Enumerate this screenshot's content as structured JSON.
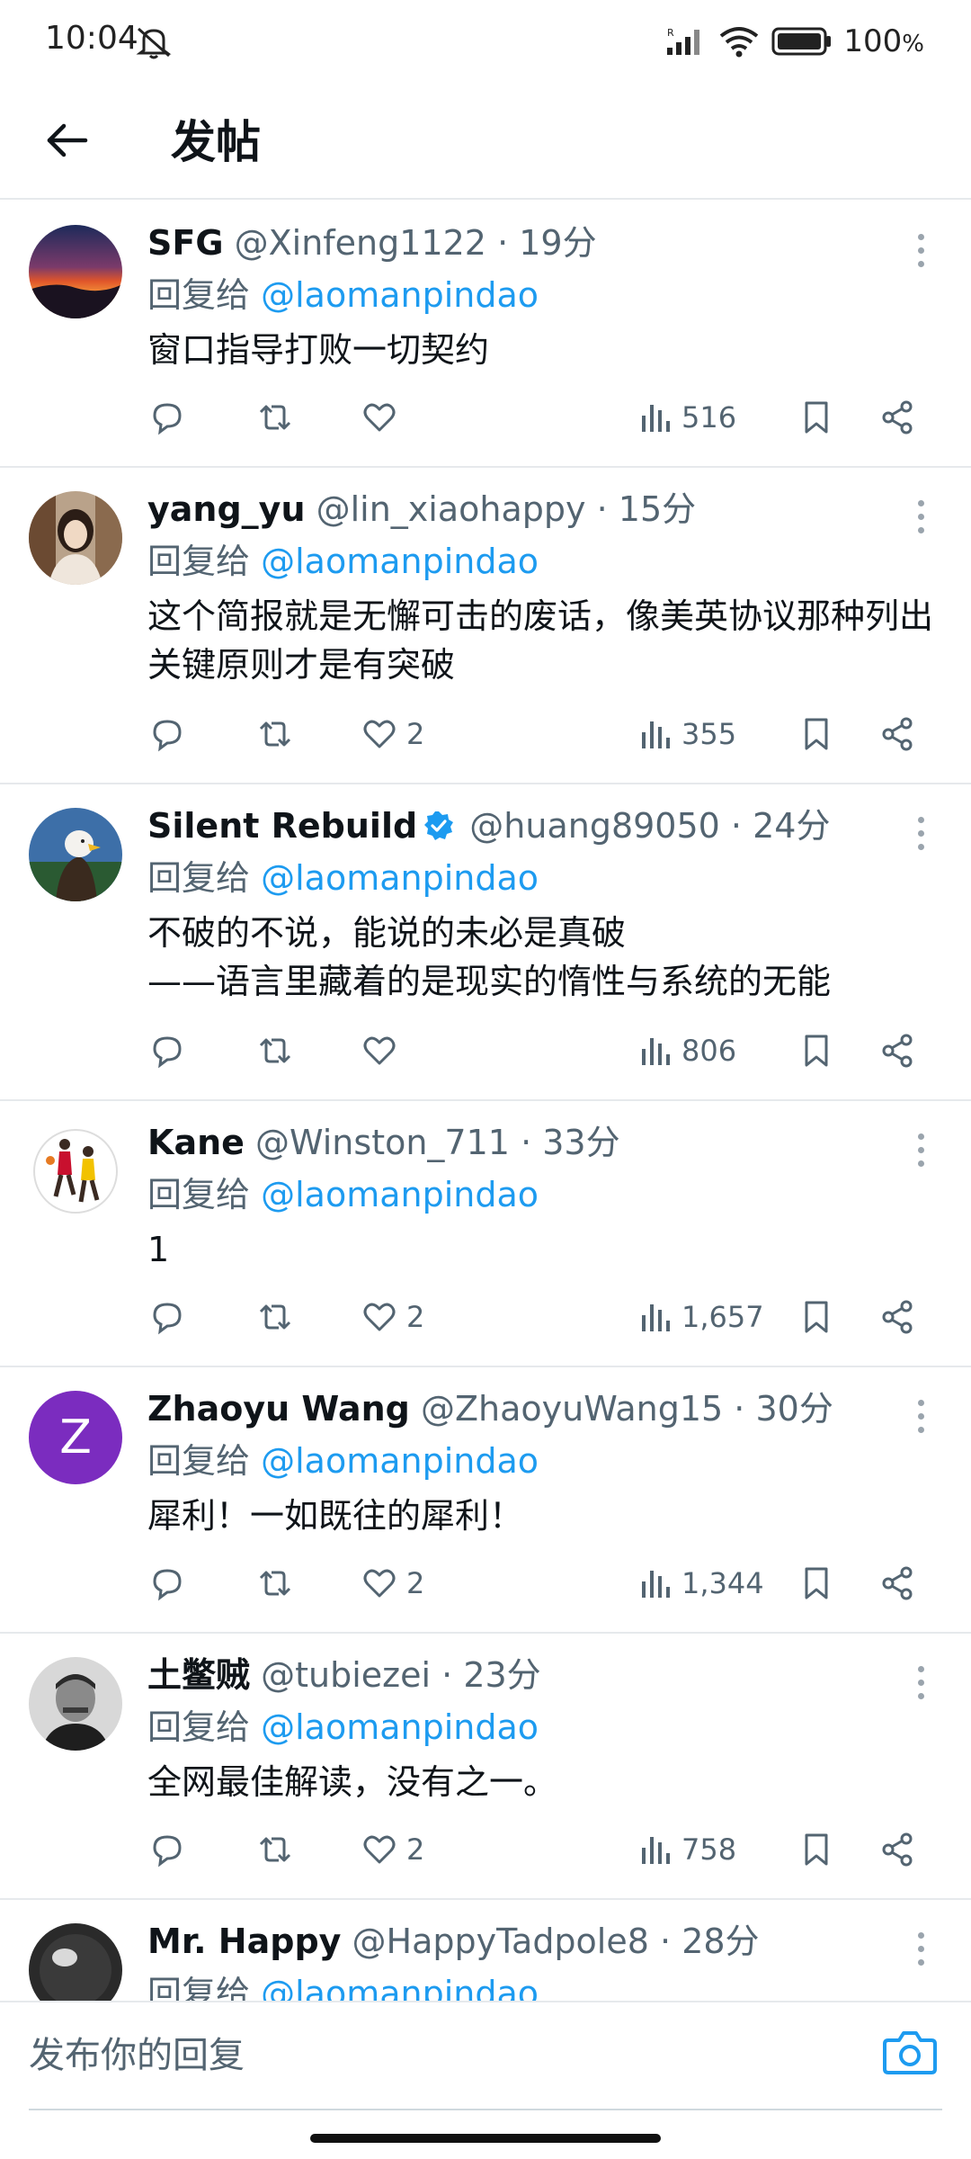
{
  "status_bar": {
    "time": "10:04",
    "battery_percent": "100",
    "battery_unit": "%"
  },
  "header": {
    "title": "发帖"
  },
  "replies": [
    {
      "name": "SFG",
      "handle": "@Xinfeng1122",
      "separator": "·",
      "time": "19分",
      "reply_prefix": "回复给",
      "reply_to": "@laomanpindao",
      "text": "窗口指导打败一切契约",
      "likes": "",
      "views": "516",
      "verified": false,
      "avatar": "sunset-avatar"
    },
    {
      "name": "yang_yu",
      "handle": "@lin_xiaohappy",
      "separator": "·",
      "time": "15分",
      "reply_prefix": "回复给",
      "reply_to": "@laomanpindao",
      "text": "这个简报就是无懈可击的废话，像美英协议那种列出关键原则才是有突破",
      "likes": "2",
      "views": "355",
      "verified": false,
      "avatar": "woman-photo-avatar"
    },
    {
      "name": "Silent Rebuild",
      "handle": "@huang89050",
      "separator": "·",
      "time": "24分",
      "reply_prefix": "回复给",
      "reply_to": "@laomanpindao",
      "text": "不破的不说，能说的未必是真破\n——语言里藏着的是现实的惰性与系统的无能",
      "likes": "",
      "views": "806",
      "verified": true,
      "avatar": "eagle-avatar"
    },
    {
      "name": "Kane",
      "handle": "@Winston_711",
      "separator": "·",
      "time": "33分",
      "reply_prefix": "回复给",
      "reply_to": "@laomanpindao",
      "text": "1",
      "likes": "2",
      "views": "1,657",
      "verified": false,
      "avatar": "basketball-players-avatar"
    },
    {
      "name": "Zhaoyu Wang",
      "handle": "@ZhaoyuWang15",
      "separator": "·",
      "time": "30分",
      "reply_prefix": "回复给",
      "reply_to": "@laomanpindao",
      "text": "犀利！一如既往的犀利！",
      "likes": "2",
      "views": "1,344",
      "verified": false,
      "avatar_letter": "Z",
      "avatar_color": "#7b2cbf"
    },
    {
      "name": "土鳖贼",
      "handle": "@tubiezei",
      "separator": "·",
      "time": "23分",
      "reply_prefix": "回复给",
      "reply_to": "@laomanpindao",
      "text": "全网最佳解读，没有之一。",
      "likes": "2",
      "views": "758",
      "verified": false,
      "avatar": "vintage-portrait-avatar"
    },
    {
      "name": "Mr. Happy",
      "handle": "@HappyTadpole8",
      "separator": "·",
      "time": "28分",
      "reply_prefix": "回复给",
      "reply_to": "@laomanpindao",
      "text": "",
      "likes": "",
      "views": "",
      "verified": false,
      "avatar": "dark-sphere-avatar"
    }
  ],
  "composer": {
    "placeholder": "发布你的回复"
  },
  "colors": {
    "link": "#1d9bf0",
    "secondary_text": "#536471",
    "primary_text": "#0f1419",
    "divider": "#e6e9ec",
    "verified_badge": "#1d9bf0",
    "composer_camera": "#1d9bf0"
  }
}
